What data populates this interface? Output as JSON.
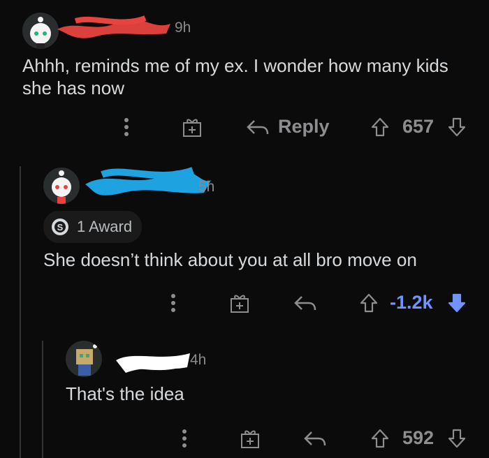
{
  "comments": [
    {
      "time": "9h",
      "text": "Ahhh, reminds me of my ex. I wonder how many kids she has now",
      "reply_label": "Reply",
      "score": "657",
      "scribble_color": "#e8433f"
    },
    {
      "time": "5h",
      "award_label": "1 Award",
      "text": "She doesn’t think about you at all bro move on",
      "score": "-1.2k",
      "scribble_color": "#1fa3e0",
      "vote_color": "#7193ff"
    },
    {
      "time": "4h",
      "text": "That's the idea",
      "score": "592",
      "scribble_color": "#ffffff"
    }
  ],
  "icons": [
    "overflow-icon",
    "gift-icon",
    "reply-arrow-icon",
    "upvote-arrow-icon",
    "downvote-arrow-icon",
    "snoo-avatar-icon",
    "award-icon"
  ]
}
